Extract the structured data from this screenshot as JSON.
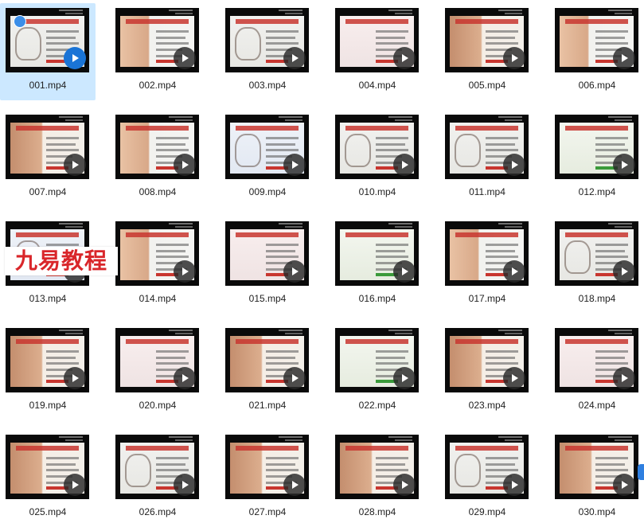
{
  "files": [
    {
      "name": "001.mp4",
      "variant": "doc",
      "selected": true
    },
    {
      "name": "002.mp4",
      "variant": "face"
    },
    {
      "name": "003.mp4",
      "variant": "doc"
    },
    {
      "name": "004.mp4",
      "variant": "red"
    },
    {
      "name": "005.mp4",
      "variant": "photo"
    },
    {
      "name": "006.mp4",
      "variant": "face"
    },
    {
      "name": "007.mp4",
      "variant": "photo"
    },
    {
      "name": "008.mp4",
      "variant": "face"
    },
    {
      "name": "009.mp4",
      "variant": "blue"
    },
    {
      "name": "010.mp4",
      "variant": "doc"
    },
    {
      "name": "011.mp4",
      "variant": "doc"
    },
    {
      "name": "012.mp4",
      "variant": "green"
    },
    {
      "name": "013.mp4",
      "variant": "blue"
    },
    {
      "name": "014.mp4",
      "variant": "face"
    },
    {
      "name": "015.mp4",
      "variant": "red"
    },
    {
      "name": "016.mp4",
      "variant": "green"
    },
    {
      "name": "017.mp4",
      "variant": "face"
    },
    {
      "name": "018.mp4",
      "variant": "doc"
    },
    {
      "name": "019.mp4",
      "variant": "photo"
    },
    {
      "name": "020.mp4",
      "variant": "red"
    },
    {
      "name": "021.mp4",
      "variant": "photo"
    },
    {
      "name": "022.mp4",
      "variant": "green"
    },
    {
      "name": "023.mp4",
      "variant": "photo"
    },
    {
      "name": "024.mp4",
      "variant": "red"
    },
    {
      "name": "025.mp4",
      "variant": "photo"
    },
    {
      "name": "026.mp4",
      "variant": "doc"
    },
    {
      "name": "027.mp4",
      "variant": "photo"
    },
    {
      "name": "028.mp4",
      "variant": "photo"
    },
    {
      "name": "029.mp4",
      "variant": "doc"
    },
    {
      "name": "030.mp4",
      "variant": "photo"
    }
  ],
  "watermark": {
    "text": "九易教程"
  },
  "colors": {
    "selection": "#cce8ff",
    "play_overlay": "#282828",
    "play_selected": "#1a74d6",
    "watermark": "#d9262a",
    "slide_header": "#c8362f"
  },
  "icons": {
    "play": "play-icon",
    "checkbox": "checkbox-icon"
  }
}
